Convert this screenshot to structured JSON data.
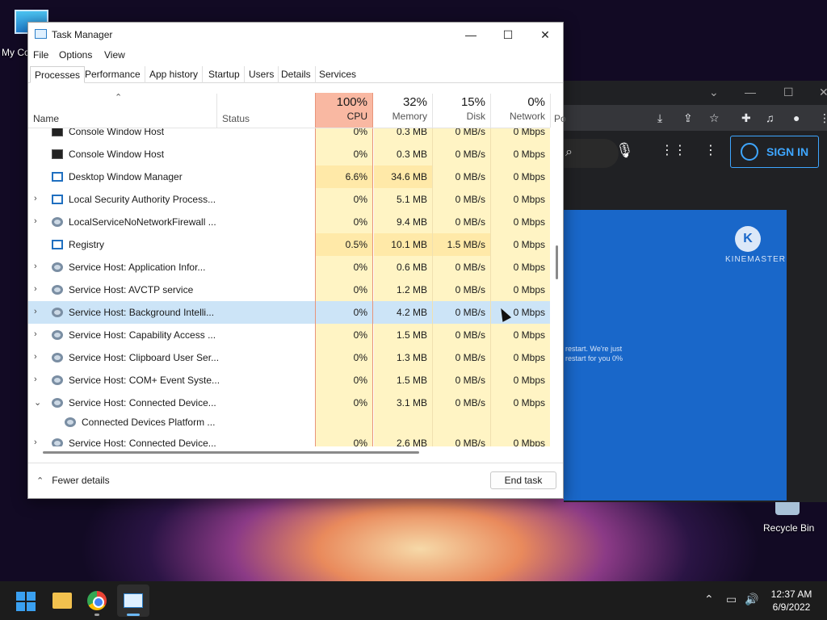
{
  "desktop": {
    "my_pc_label": "My Co",
    "recycle_bin_label": "Recycle Bin"
  },
  "browser": {
    "sign_in": "SIGN IN",
    "kinemaster_name": "KINEMASTER",
    "kinemaster_logo": "K",
    "kinemaster_msg_line1": "restart. We're just",
    "kinemaster_msg_line2": "restart for you  0%"
  },
  "task_manager": {
    "title": "Task Manager",
    "menu": [
      "File",
      "Options",
      "View"
    ],
    "tabs": [
      "Processes",
      "Performance",
      "App history",
      "Startup",
      "Users",
      "Details",
      "Services"
    ],
    "columns": {
      "name": "Name",
      "status": "Status",
      "cpu": {
        "pct": "100%",
        "label": "CPU"
      },
      "memory": {
        "pct": "32%",
        "label": "Memory"
      },
      "disk": {
        "pct": "15%",
        "label": "Disk"
      },
      "network": {
        "pct": "0%",
        "label": "Network"
      },
      "power": "Po"
    },
    "rows": [
      {
        "name": "Console Window Host",
        "cpu": "0%",
        "mem": "0.3 MB",
        "disk": "0 MB/s",
        "net": "0 Mbps"
      },
      {
        "name": "Console Window Host",
        "cpu": "0%",
        "mem": "0.3 MB",
        "disk": "0 MB/s",
        "net": "0 Mbps"
      },
      {
        "name": "Desktop Window Manager",
        "cpu": "6.6%",
        "mem": "34.6 MB",
        "disk": "0 MB/s",
        "net": "0 Mbps"
      },
      {
        "name": "Local Security Authority Process...",
        "cpu": "0%",
        "mem": "5.1 MB",
        "disk": "0 MB/s",
        "net": "0 Mbps"
      },
      {
        "name": "LocalServiceNoNetworkFirewall ...",
        "cpu": "0%",
        "mem": "9.4 MB",
        "disk": "0 MB/s",
        "net": "0 Mbps"
      },
      {
        "name": "Registry",
        "cpu": "0.5%",
        "mem": "10.1 MB",
        "disk": "1.5 MB/s",
        "net": "0 Mbps"
      },
      {
        "name": "Service Host: Application Infor...",
        "cpu": "0%",
        "mem": "0.6 MB",
        "disk": "0 MB/s",
        "net": "0 Mbps"
      },
      {
        "name": "Service Host: AVCTP service",
        "cpu": "0%",
        "mem": "1.2 MB",
        "disk": "0 MB/s",
        "net": "0 Mbps"
      },
      {
        "name": "Service Host: Background Intelli...",
        "cpu": "0%",
        "mem": "4.2 MB",
        "disk": "0 MB/s",
        "net": "0 Mbps"
      },
      {
        "name": "Service Host: Capability Access ...",
        "cpu": "0%",
        "mem": "1.5 MB",
        "disk": "0 MB/s",
        "net": "0 Mbps"
      },
      {
        "name": "Service Host: Clipboard User Ser...",
        "cpu": "0%",
        "mem": "1.3 MB",
        "disk": "0 MB/s",
        "net": "0 Mbps"
      },
      {
        "name": "Service Host: COM+ Event Syste...",
        "cpu": "0%",
        "mem": "1.5 MB",
        "disk": "0 MB/s",
        "net": "0 Mbps"
      },
      {
        "name": "Service Host: Connected Device...",
        "cpu": "0%",
        "mem": "3.1 MB",
        "disk": "0 MB/s",
        "net": "0 Mbps"
      },
      {
        "name": "Connected Devices Platform ...",
        "cpu": "",
        "mem": "",
        "disk": "",
        "net": ""
      },
      {
        "name": "Service Host: Connected Device...",
        "cpu": "0%",
        "mem": "2.6 MB",
        "disk": "0 MB/s",
        "net": "0 Mbps"
      }
    ],
    "footer": {
      "fewer_details": "Fewer details",
      "end_task": "End task"
    }
  },
  "taskbar": {
    "time": "12:37 AM",
    "date": "6/9/2022"
  }
}
